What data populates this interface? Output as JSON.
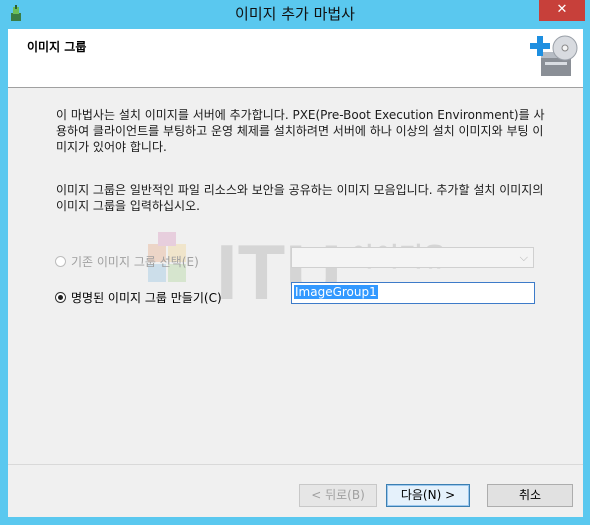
{
  "window": {
    "title": "이미지 추가 마법사",
    "close_label": "✕",
    "app_icon": "wizard-app-icon"
  },
  "header": {
    "title": "이미지 그룹",
    "icon": "add-image-disc-icon"
  },
  "content": {
    "description_1": "이 마법사는 설치 이미지를 서버에 추가합니다. PXE(Pre-Boot Execution Environment)를 사용하여 클라이언트를 부팅하고 운영 체제를 설치하려면 서버에 하나 이상의 설치 이미지와 부팅 이미지가 있어야 합니다.",
    "description_2": "이미지 그룹은 일반적인 파일 리소스와 보안을 공유하는 이미지 모음입니다. 추가할 설치 이미지의 이미지 그룹을 입력하십시오.",
    "options": [
      {
        "label": "기존 이미지 그룹 선택(E)",
        "selected": false,
        "enabled": false
      },
      {
        "label": "명명된 이미지 그룹 만들기(C)",
        "selected": true,
        "enabled": true
      }
    ],
    "existing_group_value": "",
    "new_group_value": "ImageGroup1"
  },
  "watermark": {
    "text_latin": "ITU",
    "text_korean": "아이티유"
  },
  "buttons": {
    "back": "< 뒤로(B)",
    "next": "다음(N) >",
    "cancel": "취소"
  },
  "colors": {
    "title_bar": "#5ac8ef",
    "close_button": "#c7403a",
    "selection": "#3399ff"
  }
}
